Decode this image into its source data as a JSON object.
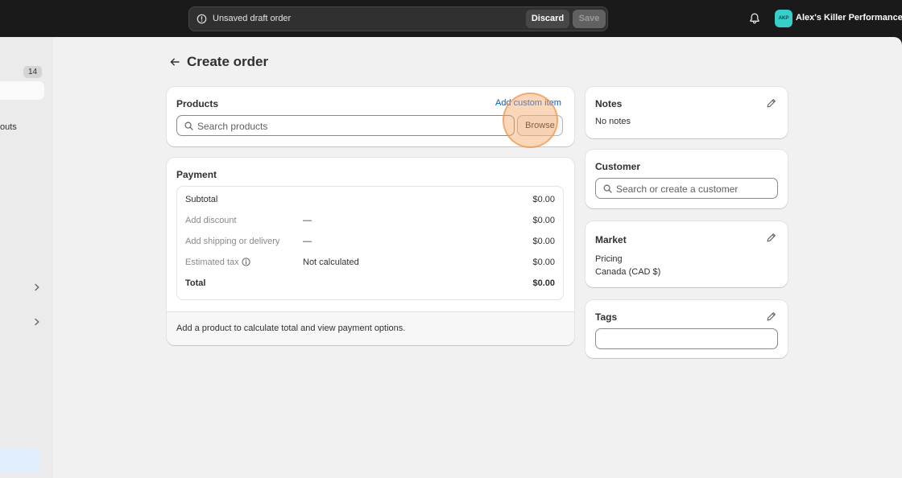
{
  "topbar": {
    "draft_label": "Unsaved draft order",
    "discard_label": "Discard",
    "save_label": "Save",
    "avatar_initials": "AKP",
    "store_name": "Alex's Killer Performance"
  },
  "sidebar": {
    "badge_count": "14",
    "partial_item_label": "outs"
  },
  "page": {
    "title": "Create order"
  },
  "products": {
    "title": "Products",
    "add_custom_item": "Add custom item",
    "search_placeholder": "Search products",
    "browse_label": "Browse"
  },
  "payment": {
    "title": "Payment",
    "rows": [
      {
        "label": "Subtotal",
        "middle": "",
        "amount": "$0.00"
      },
      {
        "label": "Add discount",
        "middle": "—",
        "amount": "$0.00"
      },
      {
        "label": "Add shipping or delivery",
        "middle": "—",
        "amount": "$0.00"
      },
      {
        "label": "Estimated tax",
        "middle": "Not calculated",
        "amount": "$0.00"
      },
      {
        "label": "Total",
        "middle": "",
        "amount": "$0.00"
      }
    ],
    "footer_text": "Add a product to calculate total and view payment options."
  },
  "notes": {
    "title": "Notes",
    "value": "No notes"
  },
  "customer": {
    "title": "Customer",
    "search_placeholder": "Search or create a customer"
  },
  "market": {
    "title": "Market",
    "pricing_label": "Pricing",
    "pricing_value": "Canada (CAD $)"
  },
  "tags": {
    "title": "Tags",
    "value": ""
  },
  "colors": {
    "accent_link": "#005bd3",
    "avatar_bg": "#36cfc9",
    "topbar_bg": "#1a1a1a",
    "page_bg": "#f1f1f1"
  }
}
